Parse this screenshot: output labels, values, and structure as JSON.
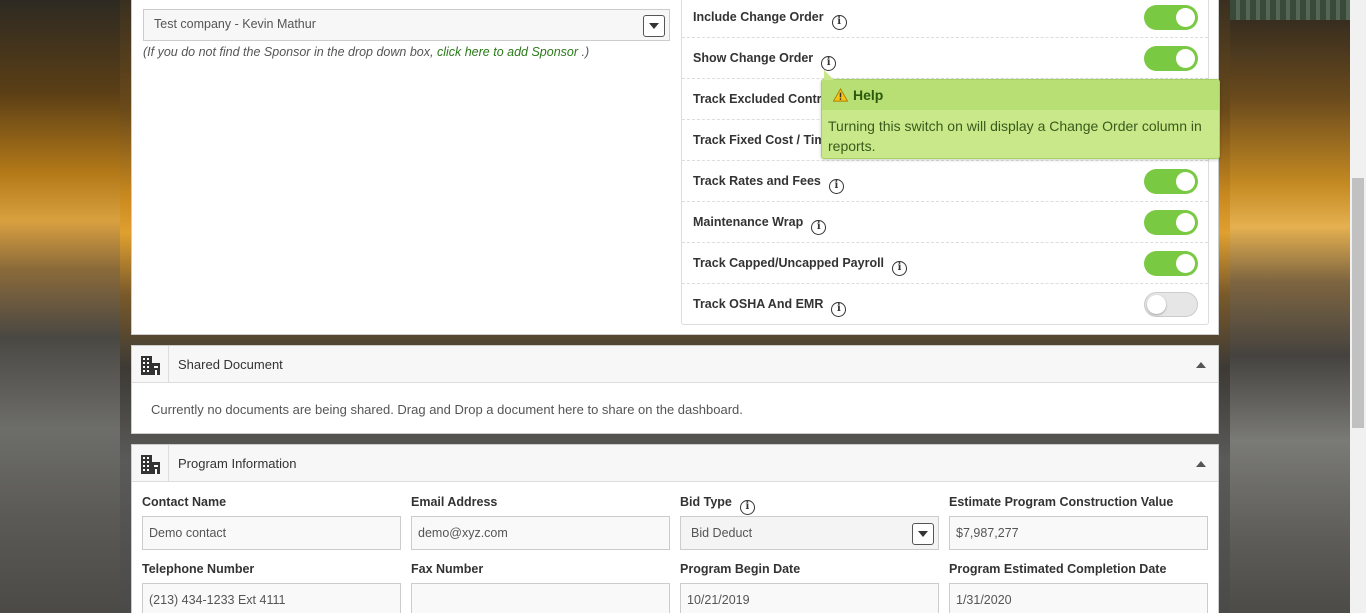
{
  "sponsor": {
    "selected": "Test company - Kevin Mathur",
    "hint_prefix": "(If you do not find the Sponsor in the drop down box,",
    "hint_link": "click here to add Sponsor",
    "hint_suffix": ".)"
  },
  "switches": [
    {
      "label": "Include Change Order",
      "on": true
    },
    {
      "label": "Show Change Order",
      "on": true
    },
    {
      "label": "Track Excluded Contra",
      "on": true
    },
    {
      "label": "Track Fixed Cost / Tim",
      "on": true
    },
    {
      "label": "Track Rates and Fees",
      "on": true
    },
    {
      "label": "Maintenance Wrap",
      "on": true
    },
    {
      "label": "Track Capped/Uncapped Payroll",
      "on": true
    },
    {
      "label": "Track OSHA And EMR",
      "on": false
    }
  ],
  "tooltip": {
    "title": "Help",
    "body": "Turning this switch on will display a Change Order column in reports."
  },
  "shared_document": {
    "title": "Shared Document",
    "message": "Currently no documents are being shared. Drag and Drop a document here to share on the dashboard."
  },
  "program_information": {
    "title": "Program Information",
    "contact_name_label": "Contact Name",
    "contact_name": "Demo contact",
    "email_label": "Email Address",
    "email": "demo@xyz.com",
    "bid_type_label": "Bid Type",
    "bid_type": "Bid Deduct",
    "estimate_label": "Estimate Program Construction Value",
    "estimate": "$7,987,277",
    "telephone_label": "Telephone Number",
    "telephone": "(213) 434-1233 Ext 4111",
    "fax_label": "Fax Number",
    "fax": "",
    "begin_date_label": "Program Begin Date",
    "begin_date": "10/21/2019",
    "completion_label": "Program Estimated Completion Date",
    "completion_date": "1/31/2020"
  },
  "colors": {
    "toggle_on": "#7ac943",
    "tooltip_bg": "#c8e88a",
    "link": "#2a7a1a"
  }
}
